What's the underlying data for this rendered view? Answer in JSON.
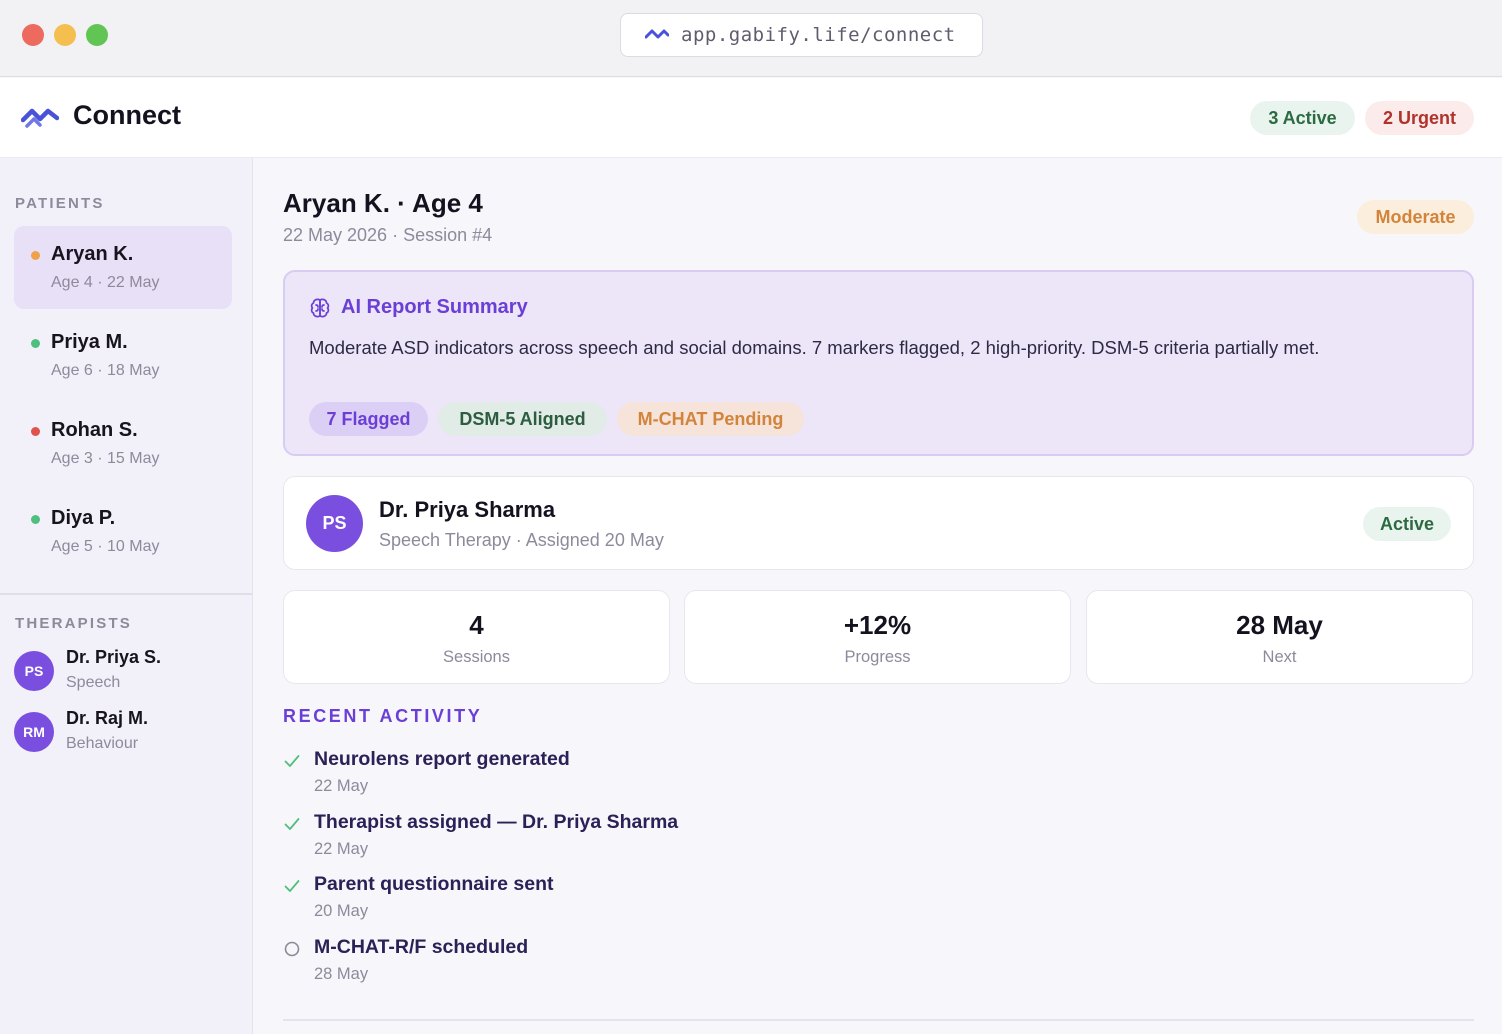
{
  "browser": {
    "url": "app.gabify.life/connect"
  },
  "header": {
    "title": "Connect",
    "active_count": "3 Active",
    "urgent_count": "2 Urgent"
  },
  "sidebar": {
    "patients_heading": "PATIENTS",
    "patients": [
      {
        "name": "Aryan K.",
        "meta": "Age 4 · 22 May",
        "status_color": "#eea24a",
        "selected": true
      },
      {
        "name": "Priya M.",
        "meta": "Age 6 · 18 May",
        "status_color": "#4fbf7d",
        "selected": false
      },
      {
        "name": "Rohan S.",
        "meta": "Age 3 · 15 May",
        "status_color": "#e0524c",
        "selected": false
      },
      {
        "name": "Diya P.",
        "meta": "Age 5 · 10 May",
        "status_color": "#4fbf7d",
        "selected": false
      }
    ],
    "therapists_heading": "THERAPISTS",
    "therapists": [
      {
        "initials": "PS",
        "name": "Dr. Priya S.",
        "specialty": "Speech"
      },
      {
        "initials": "RM",
        "name": "Dr. Raj M.",
        "specialty": "Behaviour"
      }
    ]
  },
  "main": {
    "patient_title": "Aryan K. · Age 4",
    "patient_sub": "22 May 2026 · Session #4",
    "severity": "Moderate",
    "ai_report": {
      "title": "AI Report Summary",
      "text": "Moderate ASD indicators across speech and social domains. 7 markers flagged, 2 high-priority. DSM-5 criteria partially met.",
      "tags": [
        "7 Flagged",
        "DSM-5 Aligned",
        "M-CHAT Pending"
      ]
    },
    "therapist_card": {
      "initials": "PS",
      "name": "Dr. Priya Sharma",
      "meta": "Speech Therapy · Assigned 20 May",
      "status": "Active"
    },
    "stats": [
      {
        "value": "4",
        "label": "Sessions"
      },
      {
        "value": "+12%",
        "label": "Progress"
      },
      {
        "value": "28 May",
        "label": "Next"
      }
    ],
    "activity_heading": "RECENT ACTIVITY",
    "activity": [
      {
        "text": "Neurolens report generated",
        "date": "22 May",
        "done": true
      },
      {
        "text": "Therapist assigned — Dr. Priya Sharma",
        "date": "22 May",
        "done": true
      },
      {
        "text": "Parent questionnaire sent",
        "date": "20 May",
        "done": true
      },
      {
        "text": "M-CHAT-R/F scheduled",
        "date": "28 May",
        "done": false
      }
    ]
  },
  "colors": {
    "accent": "#6b3fd6",
    "avatar": "#7a4fe0",
    "brand_icon": "#4a52d9",
    "success": "#2c6a42",
    "danger": "#b0322b",
    "warning": "#d1843a"
  }
}
